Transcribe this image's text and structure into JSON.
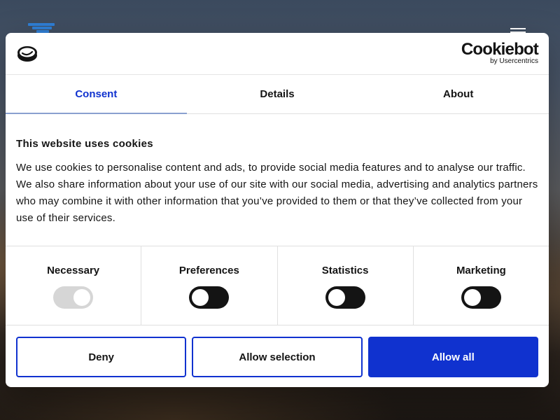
{
  "brand": {
    "name": "Cookiebot",
    "sub": "by Usercentrics"
  },
  "tabs": [
    {
      "label": "Consent",
      "active": true
    },
    {
      "label": "Details",
      "active": false
    },
    {
      "label": "About",
      "active": false
    }
  ],
  "content": {
    "title": "This website uses cookies",
    "body": "We use cookies to personalise content and ads, to provide social media features and to analyse our traffic. We also share information about your use of our site with our social media, advertising and analytics partners who may combine it with other information that you’ve provided to them or that they’ve collected from your use of their services."
  },
  "categories": [
    {
      "label": "Necessary",
      "enabled": true,
      "locked": true
    },
    {
      "label": "Preferences",
      "enabled": false,
      "locked": false
    },
    {
      "label": "Statistics",
      "enabled": false,
      "locked": false
    },
    {
      "label": "Marketing",
      "enabled": false,
      "locked": false
    }
  ],
  "buttons": {
    "deny": "Deny",
    "allow_selection": "Allow selection",
    "allow_all": "Allow all"
  },
  "colors": {
    "accent": "#1032cf",
    "text": "#141414",
    "toggle_off": "#141414",
    "toggle_locked": "#d6d6d6"
  }
}
